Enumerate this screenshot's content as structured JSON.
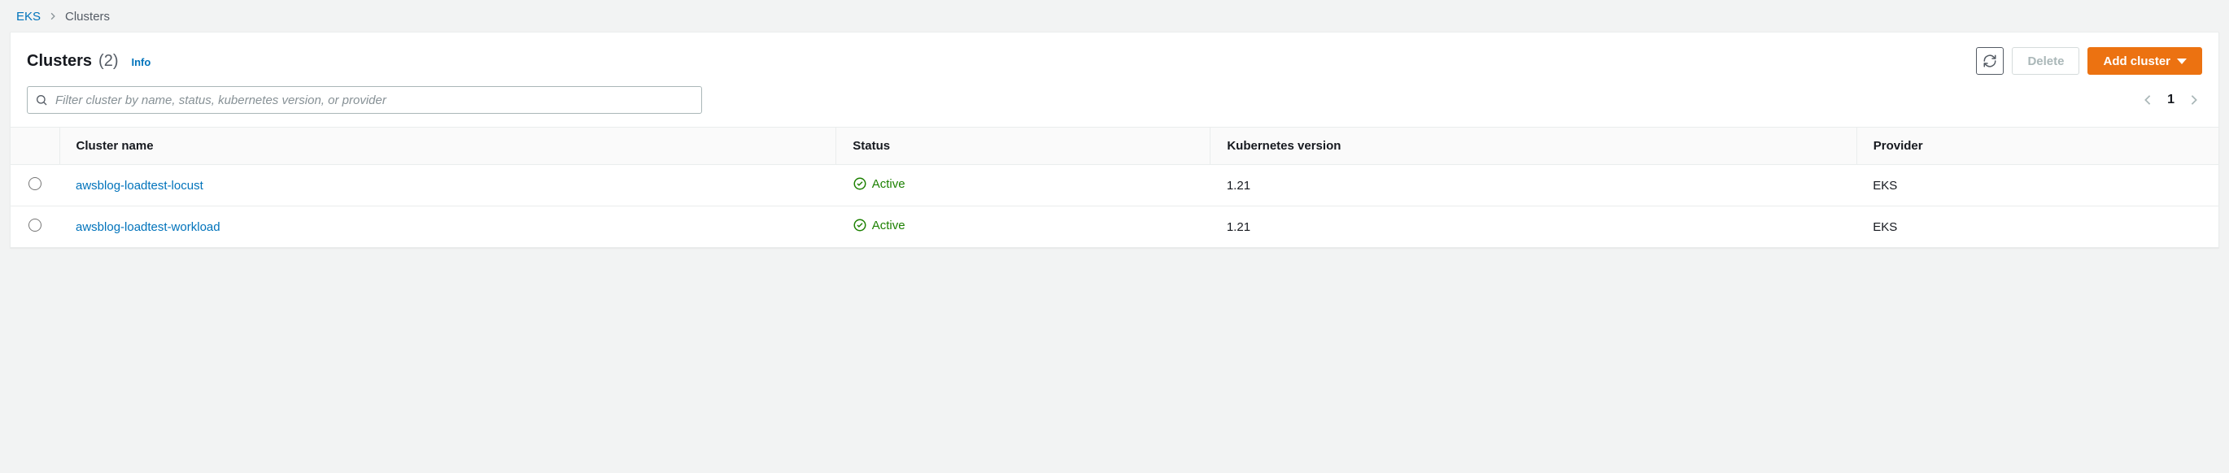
{
  "breadcrumb": {
    "root": "EKS",
    "current": "Clusters"
  },
  "header": {
    "title": "Clusters",
    "count": "(2)",
    "info": "Info"
  },
  "actions": {
    "refresh_aria": "Refresh",
    "delete": "Delete",
    "add": "Add cluster"
  },
  "search": {
    "placeholder": "Filter cluster by name, status, kubernetes version, or provider"
  },
  "pager": {
    "page": "1"
  },
  "table": {
    "columns": {
      "name": "Cluster name",
      "status": "Status",
      "version": "Kubernetes version",
      "provider": "Provider"
    },
    "rows": [
      {
        "name": "awsblog-loadtest-locust",
        "status": "Active",
        "version": "1.21",
        "provider": "EKS"
      },
      {
        "name": "awsblog-loadtest-workload",
        "status": "Active",
        "version": "1.21",
        "provider": "EKS"
      }
    ]
  }
}
